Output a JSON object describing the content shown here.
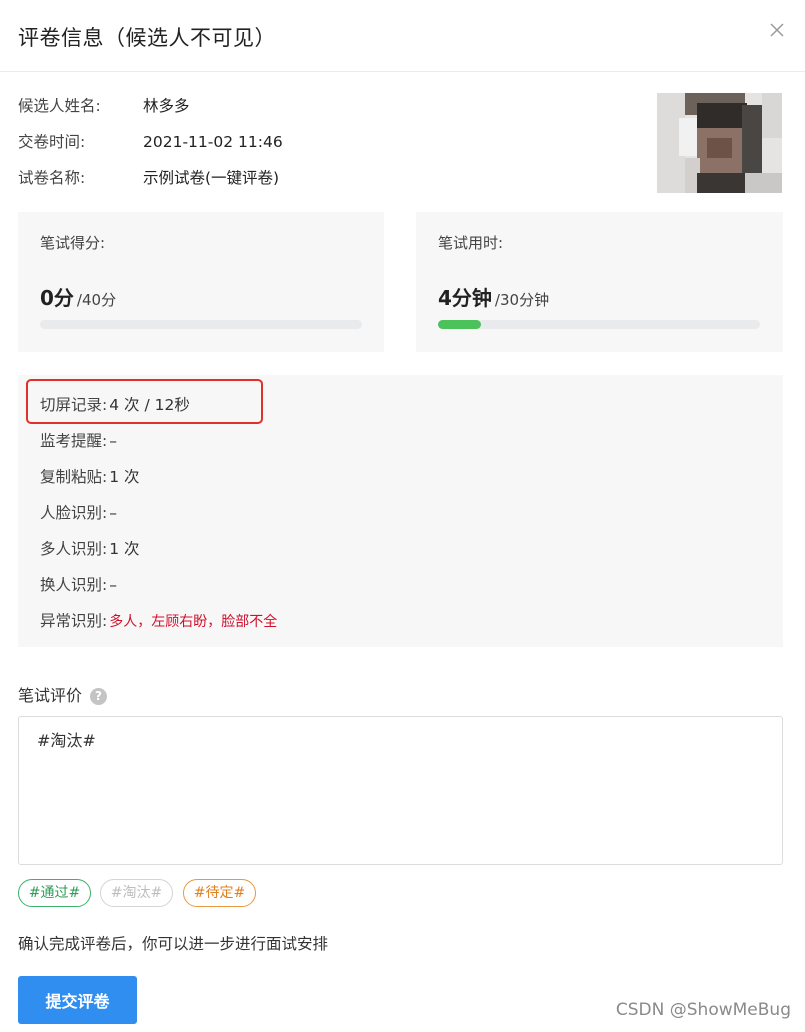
{
  "dialog": {
    "title": "评卷信息（候选人不可见）"
  },
  "candidate": [
    {
      "label": "候选人姓名:",
      "value": "林多多"
    },
    {
      "label": "交卷时间:",
      "value": "2021-11-02 11:46"
    },
    {
      "label": "试卷名称:",
      "value": "示例试卷(一键评卷)"
    }
  ],
  "score_card": {
    "label": "笔试得分:",
    "value": "0分",
    "max": "/40分",
    "progress": 0.0
  },
  "time_card": {
    "label": "笔试用时:",
    "value": "4分钟",
    "max": "/30分钟",
    "progress": 0.1333
  },
  "monitor": [
    {
      "label": "切屏记录:",
      "value": "4  次 / 12秒"
    },
    {
      "label": "监考提醒:",
      "value": "–"
    },
    {
      "label": "复制粘贴:",
      "value": "1  次"
    },
    {
      "label": "人脸识别:",
      "value": "–"
    },
    {
      "label": "多人识别:",
      "value": "1 次"
    },
    {
      "label": "换人识别:",
      "value": "–"
    },
    {
      "label": "异常识别:",
      "value": "多人，左顾右盼，脸部不全"
    }
  ],
  "evaluation": {
    "title": "笔试评价",
    "help_symbol": "?",
    "text": "#淘汰#"
  },
  "tags": {
    "pass": "#通过#",
    "fail": "#淘汰#",
    "pending": "#待定#"
  },
  "note": "确认完成评卷后，你可以进一步进行面试安排",
  "submit_label": "提交评卷",
  "watermark": "CSDN @ShowMeBug",
  "colors": {
    "primary": "#2f8ef0",
    "progress": "#4cc25a",
    "warning_text": "#d0112b",
    "highlight_box": "#e0302a"
  }
}
